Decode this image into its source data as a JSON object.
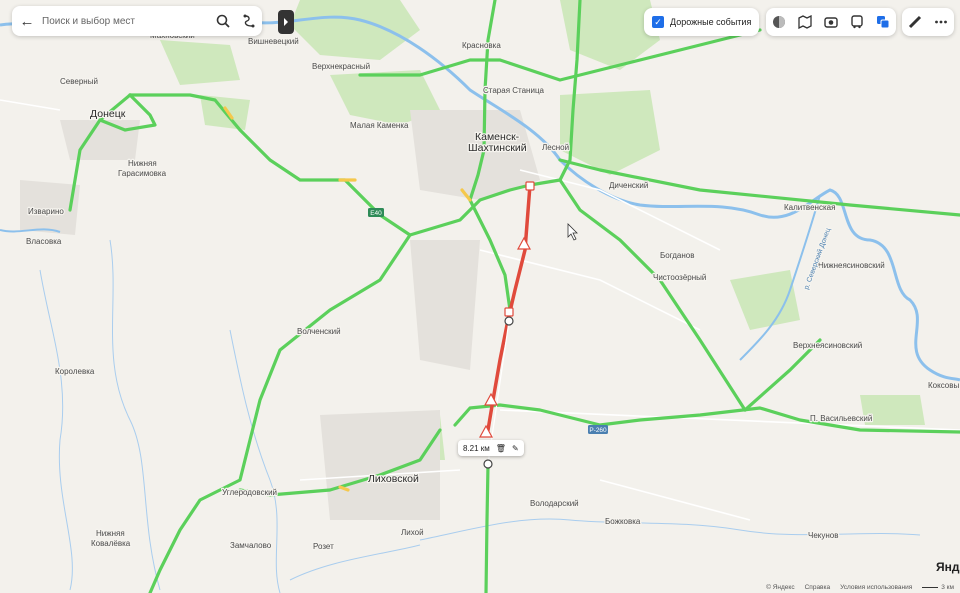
{
  "search": {
    "placeholder": "Поиск и выбор мест"
  },
  "traffic": {
    "label": "Дорожные события",
    "checked": true
  },
  "route": {
    "distance": "8.21 км"
  },
  "places": {
    "donetsk": "Донецк",
    "severny": "Северный",
    "nizhnyaya_garasimovka_1": "Нижняя",
    "nizhnyaya_garasimovka_2": "Гарасимовка",
    "izvarino": "Изварино",
    "vlasovka": "Власовка",
    "korolevka": "Королевка",
    "vishnevetsky": "Вишневецкий",
    "verkhnekrasny": "Верхнекрасный",
    "krasnovka": "Красновка",
    "staraya_stanitsa": "Старая Станица",
    "malaya_kamenka": "Малая Каменка",
    "kamensk_1": "Каменск-",
    "kamensk_2": "Шахтинский",
    "lesnoy": "Лесной",
    "dichensky": "Диченский",
    "kalitvenskaya": "Калитвенская",
    "bogdanov": "Богданов",
    "chistoozerny": "Чистоозёрный",
    "nizhneyasinovsky": "Нижнеясиновский",
    "verkhneyasinovsky": "Верхнеясиновский",
    "koksovy": "Коксовы",
    "p_vasilyevsky": "П. Васильевский",
    "volchensky": "Волченский",
    "likhovskoy": "Лиховской",
    "likhoy": "Лихой",
    "uglerodovsky": "Углеродовский",
    "zamchalovo": "Замчалово",
    "rozet": "Розет",
    "volodarsky": "Володарский",
    "bozhkovka": "Божковка",
    "chekunov": "Чекунов",
    "nizhnyaya_kovalevka_1": "Нижняя",
    "nizhnyaya_kovalevka_2": "Ковалёвка",
    "top_left_partial": "Махновский"
  },
  "river_labels": {
    "severskiy_donets": "р. Северский Донец"
  },
  "road_shields": {
    "e40": "E40",
    "r260": "Р-260"
  },
  "footer": {
    "copyright": "© Яндекс",
    "help": "Справка",
    "terms": "Условия использования",
    "scale": "3 км",
    "brand": "Янд"
  },
  "colors": {
    "traffic_free": "#5bd05b",
    "traffic_slow": "#f5c84c",
    "traffic_jam": "#e04a3c",
    "water": "#8cc0ec",
    "forest": "#c8e5b4",
    "accent": "#1e6ee8"
  },
  "icons": {
    "back": "arrow-left-icon",
    "search": "search-icon",
    "route": "route-icon",
    "layers": [
      "scheme-icon",
      "satellite-icon",
      "panorama-icon",
      "transport-icon",
      "layers-icon"
    ],
    "tools": [
      "ruler-icon",
      "more-icon"
    ]
  }
}
